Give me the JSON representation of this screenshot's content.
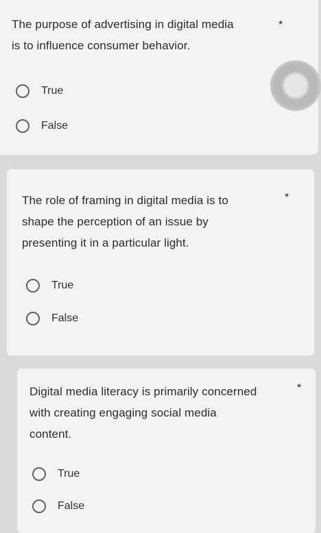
{
  "questions": [
    {
      "text_lines": [
        "The purpose of advertising in digital media",
        "is to influence consumer behavior."
      ],
      "required_mark": "*",
      "options": [
        "True",
        "False"
      ]
    },
    {
      "text_lines": [
        "The role of framing in digital media is to",
        "shape the perception of an issue by",
        "presenting it in a particular light."
      ],
      "required_mark": "*",
      "options": [
        "True",
        "False"
      ]
    },
    {
      "text_lines": [
        "Digital media literacy is primarily concerned",
        "with creating engaging social media",
        "content."
      ],
      "required_mark": "*",
      "options": [
        "True",
        "False"
      ]
    }
  ]
}
